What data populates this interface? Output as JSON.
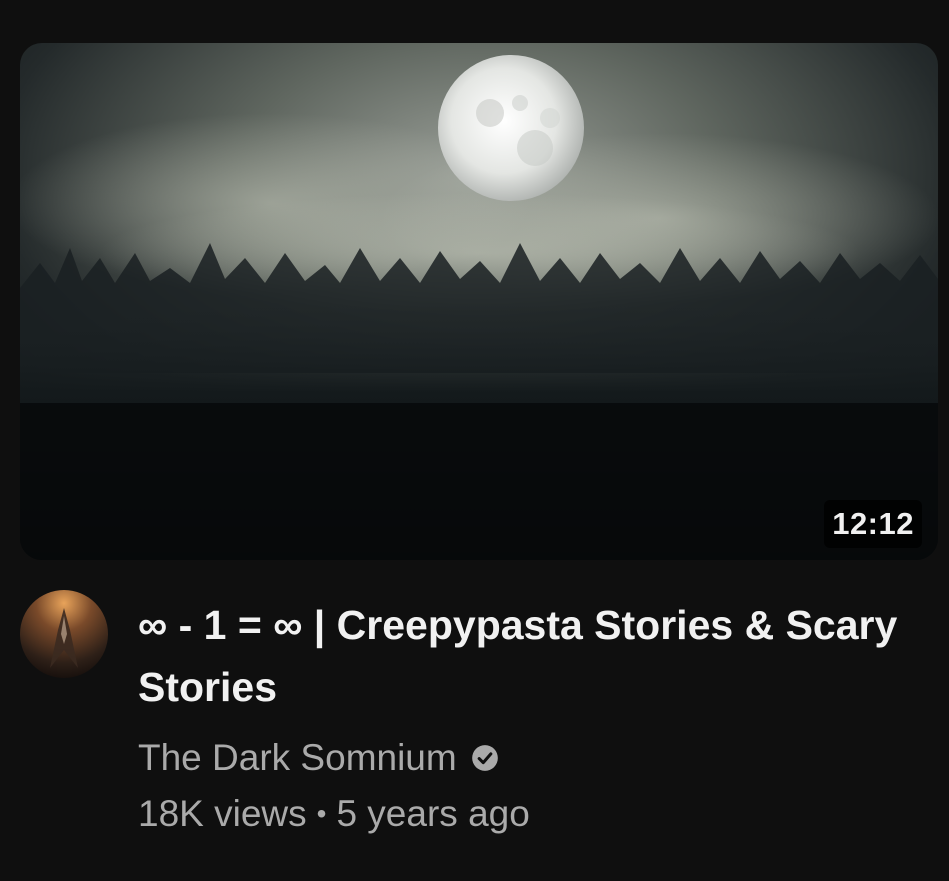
{
  "video": {
    "duration": "12:12",
    "title": "∞ - 1 = ∞ | Creepypasta Stories & Scary Stories",
    "channel": "The Dark Somnium",
    "views": "18K views",
    "separator": "•",
    "age": "5 years ago"
  },
  "icons": {
    "verified": "verified-check-icon"
  },
  "colors": {
    "background": "#0f0f0f",
    "title_text": "#f1f1f1",
    "secondary_text": "#aaaaaa"
  }
}
